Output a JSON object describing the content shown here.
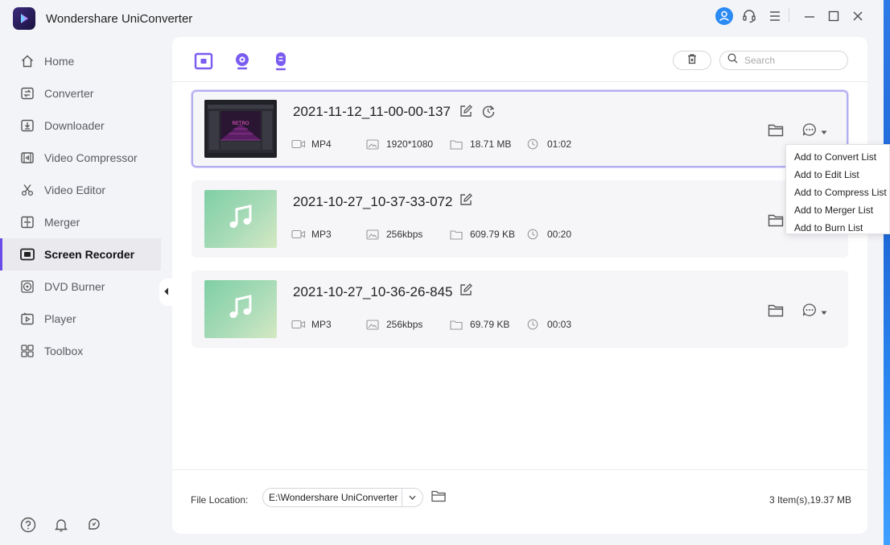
{
  "app": {
    "title": "Wondershare UniConverter"
  },
  "colors": {
    "accent": "#6a4de8",
    "user_avatar": "#2b8af3"
  },
  "sidebar": {
    "items": [
      {
        "label": "Home",
        "icon": "home-icon"
      },
      {
        "label": "Converter",
        "icon": "converter-icon"
      },
      {
        "label": "Downloader",
        "icon": "downloader-icon"
      },
      {
        "label": "Video Compressor",
        "icon": "compressor-icon"
      },
      {
        "label": "Video Editor",
        "icon": "scissors-icon"
      },
      {
        "label": "Merger",
        "icon": "merger-icon"
      },
      {
        "label": "Screen Recorder",
        "icon": "screen-recorder-icon",
        "active": true
      },
      {
        "label": "DVD Burner",
        "icon": "dvd-icon"
      },
      {
        "label": "Player",
        "icon": "player-icon"
      },
      {
        "label": "Toolbox",
        "icon": "toolbox-icon"
      }
    ]
  },
  "toolbar": {
    "search_placeholder": "Search"
  },
  "files": [
    {
      "name": "2021-11-12_11-00-00-137",
      "format": "MP4",
      "resolution": "1920*1080",
      "size": "18.71 MB",
      "duration": "01:02",
      "type": "video",
      "thumb_text": "RETRO"
    },
    {
      "name": "2021-10-27_10-37-33-072",
      "format": "MP3",
      "resolution": "256kbps",
      "size": "609.79 KB",
      "duration": "00:20",
      "type": "audio"
    },
    {
      "name": "2021-10-27_10-36-26-845",
      "format": "MP3",
      "resolution": "256kbps",
      "size": "69.79 KB",
      "duration": "00:03",
      "type": "audio"
    }
  ],
  "dropdown": {
    "options": [
      "Add to Convert List",
      "Add to Edit List",
      "Add to Compress List",
      "Add to Merger List",
      "Add to Burn List"
    ]
  },
  "footer": {
    "location_label": "File Location:",
    "location_value": "E:\\Wondershare UniConverter",
    "summary": "3 Item(s),19.37 MB"
  }
}
